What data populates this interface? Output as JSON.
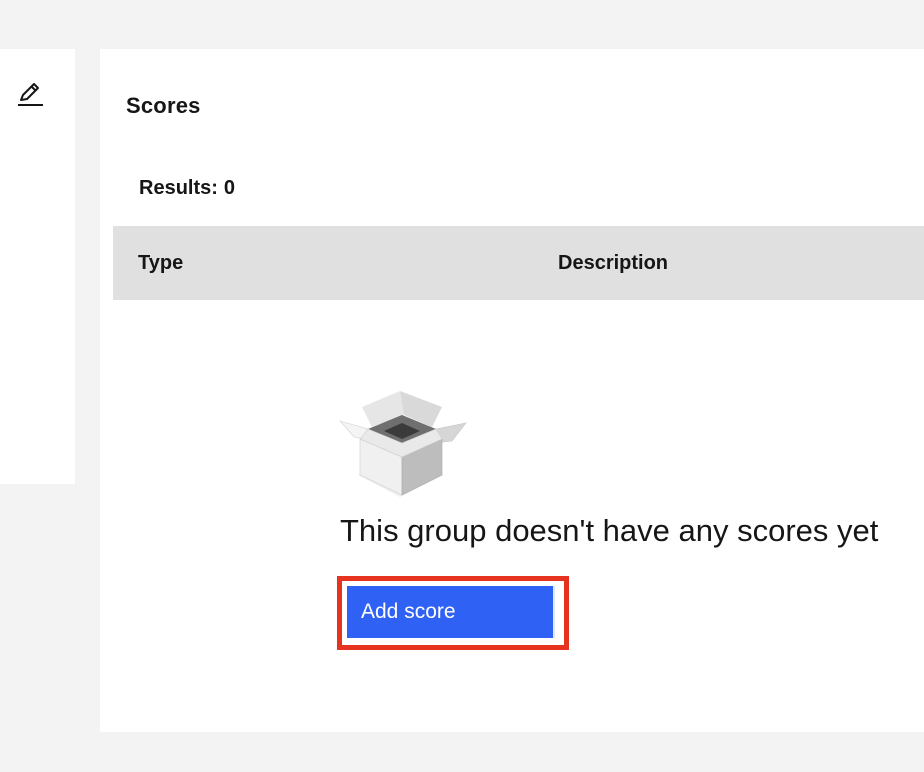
{
  "left_panel": {
    "edit_icon": "pencil-edit-icon"
  },
  "scores": {
    "title": "Scores",
    "results_label": "Results:",
    "results_count": "0",
    "columns": [
      "Type",
      "Description"
    ],
    "empty_state": {
      "icon": "empty-box-icon",
      "message": "This group doesn't have any scores yet",
      "button_label": "Add score"
    }
  },
  "colors": {
    "primary_button": "#2f61f5",
    "highlight_border": "#e5331f",
    "table_header_bg": "#e0e0e0",
    "page_bg": "#f3f3f3"
  }
}
